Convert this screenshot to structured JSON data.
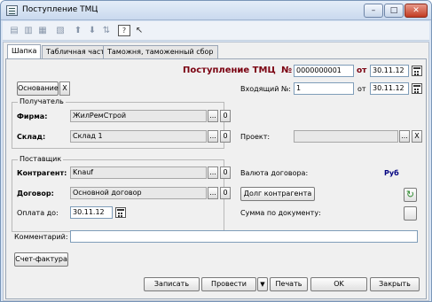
{
  "window": {
    "title": "Поступление ТМЦ",
    "buttons": {
      "minimize": "–",
      "maximize": "□",
      "close": "✕"
    }
  },
  "toolbar": {
    "icons": [
      "new-row-icon",
      "copy-row-icon",
      "delete-row-icon",
      "edit-row-icon",
      "move-up-icon",
      "move-down-icon",
      "sort-icon",
      "help-icon",
      "pointer-help-icon"
    ]
  },
  "tabs": [
    "Шапка",
    "Табличная часть",
    "Таможня, таможенный сбор"
  ],
  "header": {
    "doc_title": "Поступление ТМЦ",
    "number_label": "№",
    "number": "0000000001",
    "date_label": "от",
    "date": "30.11.12",
    "basis_button": "Основание",
    "clear_x": "X",
    "incoming_label": "Входящий №:",
    "incoming_number": "1",
    "incoming_date_label": "от",
    "incoming_date": "30.11.12"
  },
  "recipient": {
    "group_label": "Получатель",
    "firm_label": "Фирма:",
    "firm": "ЖилРемСтрой",
    "warehouse_label": "Склад:",
    "warehouse": "Склад 1",
    "dots": "...",
    "zero": "0"
  },
  "project": {
    "label": "Проект:",
    "value": "",
    "dots": "...",
    "clear": "X"
  },
  "supplier": {
    "group_label": "Поставщик",
    "contractor_label": "Контрагент:",
    "contractor": "Knauf",
    "contract_label": "Договор:",
    "contract": "Основной договор",
    "payment_label": "Оплата до:",
    "payment_date": "30.11.12",
    "dots": "...",
    "zero": "0"
  },
  "currency": {
    "label": "Валюта договора:",
    "value": "Руб",
    "debt_button": "Долг контрагента",
    "sum_label": "Сумма по документу:"
  },
  "comment": {
    "label": "Комментарий:",
    "value": ""
  },
  "invoice_button": "Счет-фактура",
  "footer": {
    "save": "Записать",
    "post": "Провести",
    "post_arrow": "▼",
    "print": "Печать",
    "ok": "OK",
    "close": "Закрыть"
  },
  "colors": {
    "doc_title": "#7a0010",
    "currency_value": "#000080",
    "refresh_icon": "#2e8b2e"
  }
}
